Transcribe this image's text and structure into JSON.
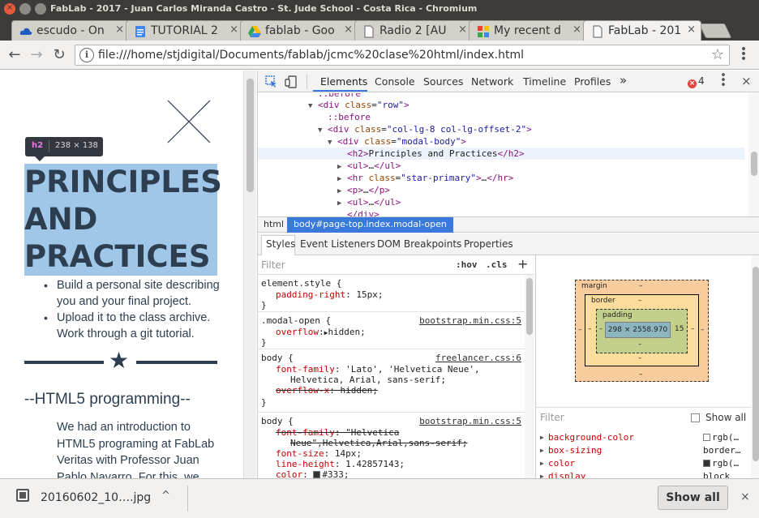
{
  "window": {
    "title": "FabLab - 2017 - Juan Carlos Miranda Castro - St. Jude School - Costa Rica - Chromium"
  },
  "tabs": [
    {
      "label": "escudo - On",
      "icon": "cloud-icon",
      "color": "#1e5bbf"
    },
    {
      "label": "TUTORIAL 2",
      "icon": "docs-icon",
      "color": "#4285f4"
    },
    {
      "label": "fablab - Goo",
      "icon": "drive-icon",
      "color": "#34a853"
    },
    {
      "label": "Radio 2 [AU",
      "icon": "page-icon",
      "color": "#777777"
    },
    {
      "label": "My recent d",
      "icon": "grid-icon",
      "color": "#e8a317"
    },
    {
      "label": "FabLab - 201",
      "icon": "page-icon",
      "color": "#777777",
      "active": true
    }
  ],
  "toolbar": {
    "url": "file:///home/stjdigital/Documents/fablab/jcmc%20clase%20html/index.html"
  },
  "page": {
    "tooltip_tag": "h2",
    "tooltip_size": "238 × 138",
    "heading_lines": [
      "PRINCIPLES",
      "AND",
      "PRACTICES"
    ],
    "bullets": [
      "Build a personal site describing you and your final project.",
      "Upload it to the class archive. Work through a git tutorial."
    ],
    "section_heading": "--HTML5 programming--",
    "section_paragraph": "We had an introduction to HTML5 programing at FabLab Veritas with Professor Juan Pablo Navarro. For this, we"
  },
  "devtools": {
    "tabs": [
      "Elements",
      "Console",
      "Sources",
      "Network",
      "Timeline",
      "Profiles"
    ],
    "active_tab": "Elements",
    "error_count": "4",
    "breadcrumbs": [
      "html",
      "body#page-top.index.modal-open"
    ],
    "style_tabs": [
      "Styles",
      "Event Listeners",
      "DOM Breakpoints",
      "Properties"
    ],
    "filter_placeholder": "Filter",
    "hov": ":hov",
    "cls": ".cls",
    "box_model": {
      "margin_label": "margin",
      "border_label": "border",
      "padding_label": "padding",
      "content": "298 × 2558.970",
      "padding_right": "15",
      "dash": "–"
    },
    "computed_filter_placeholder": "Filter",
    "show_all_label": "Show all",
    "computed": [
      {
        "name": "background-color",
        "value": "rgb(…",
        "swatch": "#ffffff"
      },
      {
        "name": "box-sizing",
        "value": "border…"
      },
      {
        "name": "color",
        "value": "rgb(…",
        "swatch": "#333333"
      },
      {
        "name": "display",
        "value": "block"
      }
    ]
  },
  "download": {
    "filename": "20160602_10….jpg",
    "show_all": "Show all"
  }
}
